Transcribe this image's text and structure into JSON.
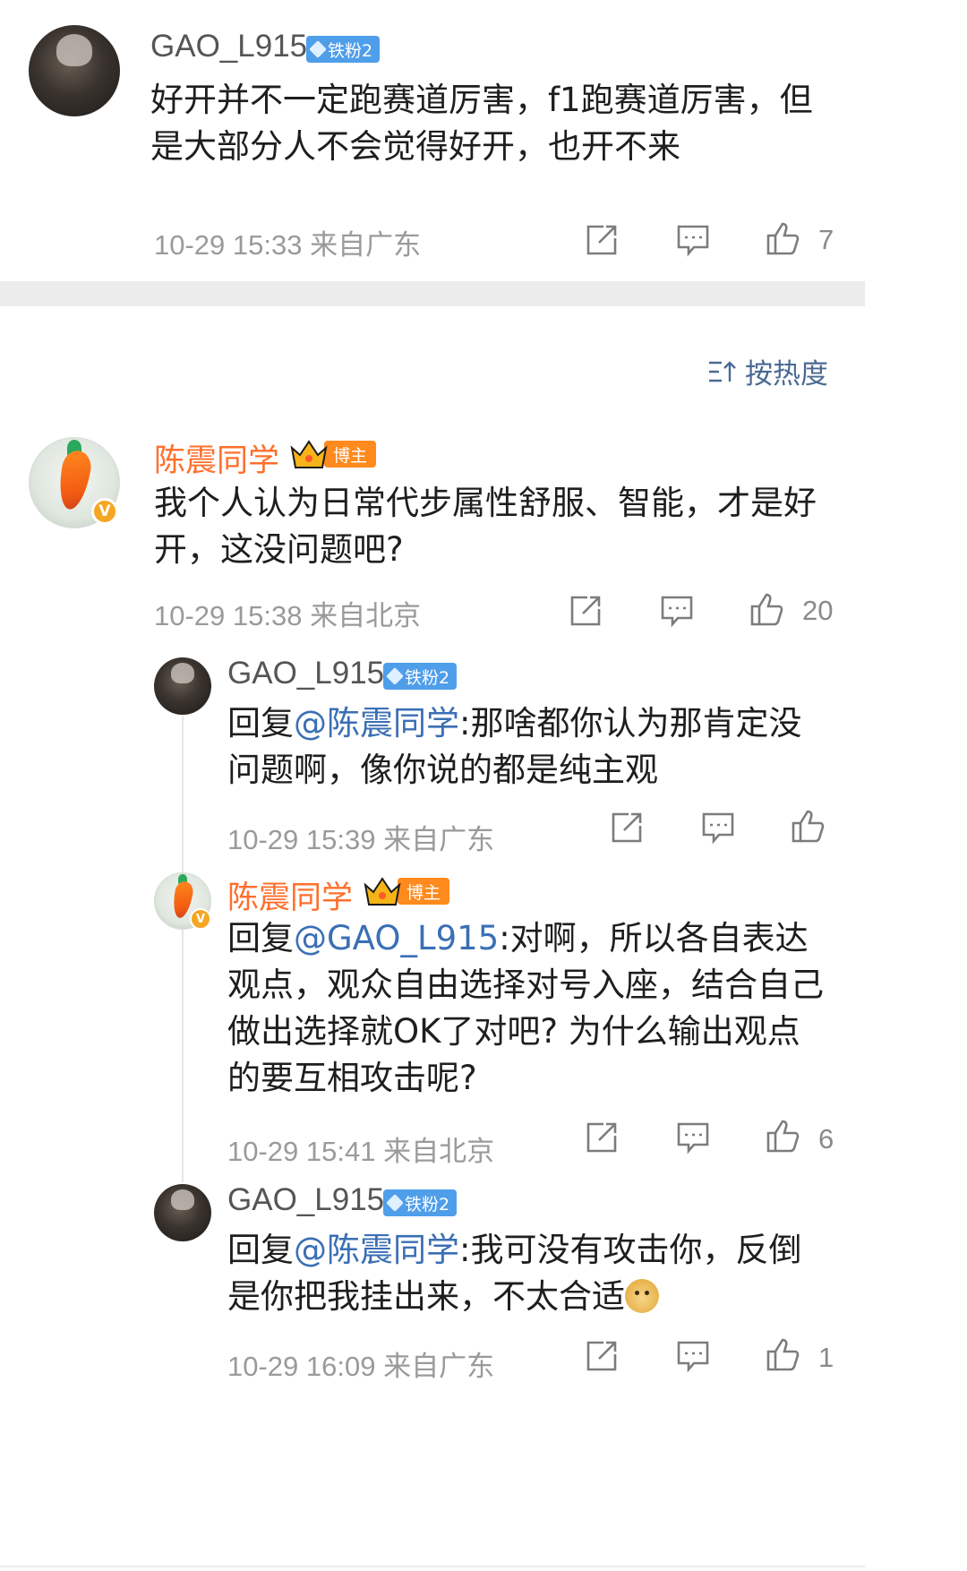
{
  "top_comment": {
    "username": "GAO_L915",
    "badge": "铁粉2",
    "text": "好开并不一定跑赛道厉害，f1跑赛道厉害，但是大部分人不会觉得好开，也开不来",
    "meta": "10-29 15:33 来自广东",
    "likes": "7"
  },
  "sort": {
    "label": "按热度"
  },
  "main_comment": {
    "username": "陈震同学",
    "badge": "博主",
    "text": "我个人认为日常代步属性舒服、智能，才是好开，这没问题吧?",
    "meta": "10-29 15:38 来自北京",
    "likes": "20"
  },
  "replies": [
    {
      "username": "GAO_L915",
      "badge": "铁粉2",
      "reply_prefix": "回复",
      "mention": "@陈震同学",
      "text": ":那啥都你认为那肯定没问题啊，像你说的都是纯主观",
      "meta": "10-29 15:39 来自广东",
      "likes": ""
    },
    {
      "username": "陈震同学",
      "badge": "博主",
      "reply_prefix": "回复",
      "mention": "@GAO_L915",
      "text": ":对啊，所以各自表达观点，观众自由选择对号入座，结合自己做出选择就OK了对吧? 为什么输出观点的要互相攻击呢?",
      "meta": "10-29 15:41 来自北京",
      "likes": "6"
    },
    {
      "username": "GAO_L915",
      "badge": "铁粉2",
      "reply_prefix": "回复",
      "mention": "@陈震同学",
      "text": ":我可没有攻击你，反倒是你把我挂出来，不太合适",
      "emoji": "doge-emoji",
      "meta": "10-29 16:09 来自广东",
      "likes": "1"
    }
  ],
  "icons": [
    "share-icon",
    "comment-icon",
    "like-icon",
    "sort-icon",
    "diamond-icon",
    "crown-icon",
    "verified-v-icon"
  ],
  "colors": {
    "name_blogger": "#ff6f2c",
    "mention": "#3a6fb5",
    "fan_badge": "#4f9eea",
    "blogger_tag": "#ff8a1e",
    "meta": "#9a9a9a"
  }
}
